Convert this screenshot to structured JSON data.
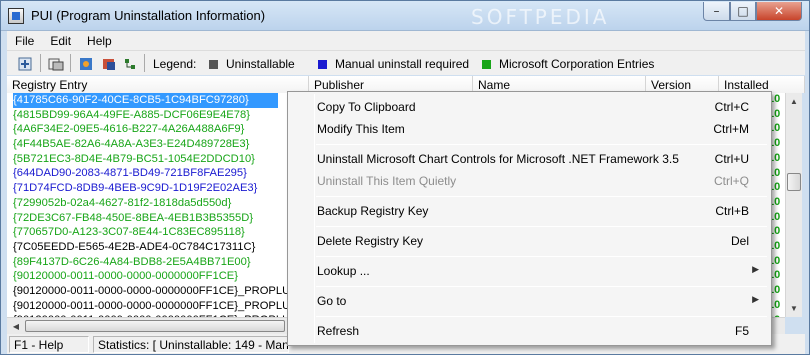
{
  "window": {
    "title": "PUI (Program Uninstallation Information)",
    "watermark": "SOFTPEDIA"
  },
  "controls": {
    "minimize": "–",
    "maximize": "□",
    "close": "✕"
  },
  "menu": [
    "File",
    "Edit",
    "Help"
  ],
  "toolbar": {
    "icons": [
      "uninstall-icon",
      "registry-icon",
      "bookmark-icon",
      "tree-icon"
    ],
    "legend_label": "Legend:",
    "legend": [
      {
        "label": "Uninstallable",
        "color": "#555555"
      },
      {
        "label": "Manual uninstall required",
        "color": "#1a1ad0"
      },
      {
        "label": "Microsoft Corporation Entries",
        "color": "#18a518"
      }
    ]
  },
  "columns": [
    "Registry Entry",
    "Publisher",
    "Name",
    "Version",
    "Installed"
  ],
  "rows": [
    {
      "text": "{41785C66-90F2-40CE-8CB5-1C94BFC97280}",
      "color": "green",
      "selected": true
    },
    {
      "text": "{4815BD99-96A4-49FE-A885-DCF06E9E4E78}",
      "color": "green"
    },
    {
      "text": "{4A6F34E2-09E5-4616-B227-4A26A488A6F9}",
      "color": "green"
    },
    {
      "text": "{4F44B5AE-82A6-4A8A-A3E3-E24D489728E3}",
      "color": "green"
    },
    {
      "text": "{5B721EC3-8D4E-4B79-BC51-1054E2DDCD10}",
      "color": "green"
    },
    {
      "text": "{644DAD90-2083-4871-BD49-721BF8FAE295}",
      "color": "blue"
    },
    {
      "text": "{71D74FCD-8DB9-4BEB-9C9D-1D19F2E02AE3}",
      "color": "blue"
    },
    {
      "text": "{7299052b-02a4-4627-81f2-1818da5d550d}",
      "color": "green"
    },
    {
      "text": "{72DE3C67-FB48-450E-8BEA-4EB1B3B5355D}",
      "color": "green"
    },
    {
      "text": "{770657D0-A123-3C07-8E44-1C83EC895118}",
      "color": "green"
    },
    {
      "text": "{7C05EEDD-E565-4E2B-ADE4-0C784C17311C}",
      "color": "black"
    },
    {
      "text": "{89F4137D-6C26-4A84-BDB8-2E5A4BB71E00}",
      "color": "green"
    },
    {
      "text": "{90120000-0011-0000-0000-0000000FF1CE}",
      "color": "green"
    },
    {
      "text": "{90120000-0011-0000-0000-0000000FF1CE}_PROPLUS",
      "color": "black"
    },
    {
      "text": "{90120000-0011-0000-0000-0000000FF1CE}_PROPLUS",
      "color": "black"
    },
    {
      "text": "{90120000-0011-0000-0000-0000000FF1CE}_PROPLUS",
      "color": "black"
    },
    {
      "text": "{90120000-0011-0000-0000-0000000FF1CE}_PROPLUS",
      "color": "black"
    }
  ],
  "right_col_values": [
    "10",
    "10",
    "10",
    "10",
    "10",
    "10",
    "10",
    "10",
    "10",
    "10",
    "10",
    "10",
    "10",
    "10",
    "10",
    "10"
  ],
  "context_menu": [
    {
      "label": "Copy To Clipboard",
      "shortcut": "Ctrl+C"
    },
    {
      "label": "Modify This Item",
      "shortcut": "Ctrl+M"
    },
    {
      "sep": true
    },
    {
      "label": "Uninstall Microsoft Chart Controls for Microsoft .NET Framework 3.5",
      "shortcut": "Ctrl+U"
    },
    {
      "label": "Uninstall This Item Quietly",
      "shortcut": "Ctrl+Q",
      "disabled": true
    },
    {
      "sep": true
    },
    {
      "label": "Backup Registry Key",
      "shortcut": "Ctrl+B"
    },
    {
      "sep": true
    },
    {
      "label": "Delete Registry Key",
      "shortcut": "Del"
    },
    {
      "sep": true
    },
    {
      "label": "Lookup ...",
      "submenu": true
    },
    {
      "sep": true
    },
    {
      "label": "Go to",
      "submenu": true
    },
    {
      "sep": true
    },
    {
      "label": "Refresh",
      "shortcut": "F5"
    }
  ],
  "status": {
    "help": "F1 - Help",
    "stats": "Statistics: [ Uninstallable: 149 - Manual U"
  }
}
